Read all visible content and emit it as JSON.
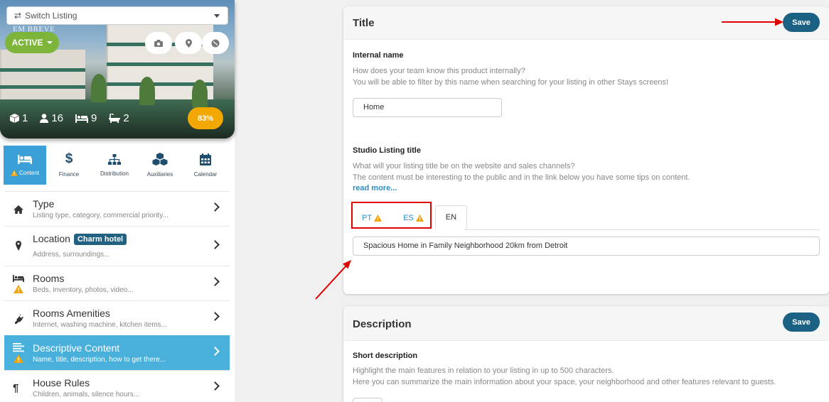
{
  "sidebar": {
    "switch_listing": "Switch Listing",
    "hero_watermark": "EM BREVE",
    "status": "ACTIVE",
    "stats": [
      {
        "icon": "cube-icon",
        "value": "1"
      },
      {
        "icon": "guests-icon",
        "value": "16"
      },
      {
        "icon": "bed-icon",
        "value": "9"
      },
      {
        "icon": "bathtub-icon",
        "value": "2"
      }
    ],
    "score": "83%",
    "category_tabs": [
      {
        "label": "Content",
        "icon": "bed-icon",
        "warning": true,
        "active": true
      },
      {
        "label": "Finance",
        "icon": "dollar-icon"
      },
      {
        "label": "Distribution",
        "icon": "sitemap-icon"
      },
      {
        "label": "Auxiliaries",
        "icon": "cubes-icon"
      },
      {
        "label": "Calendar",
        "icon": "calendar-icon"
      }
    ],
    "menu": [
      {
        "title": "Type",
        "subtitle": "Listing type, category, commercial priority...",
        "icon": "home-icon"
      },
      {
        "title": "Location",
        "badge": "Charm hotel",
        "subtitle": "Address, surroundings...",
        "icon": "map-pin-icon"
      },
      {
        "title": "Rooms",
        "subtitle": "Beds, inventory, photos, video...",
        "icon": "bed-icon",
        "warning": true
      },
      {
        "title": "Rooms Amenities",
        "subtitle": "Internet, washing machine, kitchen items...",
        "icon": "plug-icon"
      },
      {
        "title": "Descriptive Content",
        "subtitle": "Name, title, description, how to get there...",
        "icon": "lines-icon",
        "warning": true,
        "active": true
      },
      {
        "title": "House Rules",
        "subtitle": "Children, animals, silence hours...",
        "icon": "paragraph-icon"
      }
    ]
  },
  "title_panel": {
    "heading": "Title",
    "save": "Save",
    "internal_name_label": "Internal name",
    "internal_name_help_1": "How does your team know this product internally?",
    "internal_name_help_2": "You will be able to filter by this name when searching for your listing in other Stays screens!",
    "internal_name_value": "Home",
    "studio_title_label": "Studio Listing title",
    "studio_title_help_1": "What will your listing title be on the website and sales channels?",
    "studio_title_help_2": "The content must be interesting to the public and in the link below you have some tips on content.",
    "read_more": "read more...",
    "languages": [
      {
        "code": "PT",
        "warning": true
      },
      {
        "code": "ES",
        "warning": true
      },
      {
        "code": "EN",
        "active": true
      }
    ],
    "listing_title_value": "Spacious Home in Family Neighborhood 20km from Detroit"
  },
  "description_panel": {
    "heading": "Description",
    "save": "Save",
    "short_description_label": "Short description",
    "short_description_help_1": "Highlight the main features in relation to your listing in up to 500 characters.",
    "short_description_help_2": "Here you can summarize the main information about your space, your neighborhood and other features relevant to guests."
  },
  "colors": {
    "accent_blue": "#48b0db",
    "save_button": "#1a6184",
    "active_status": "#7cb53a",
    "score_badge": "#f2a800",
    "annotation_red": "#e00000",
    "warning": "#f0a30a"
  }
}
